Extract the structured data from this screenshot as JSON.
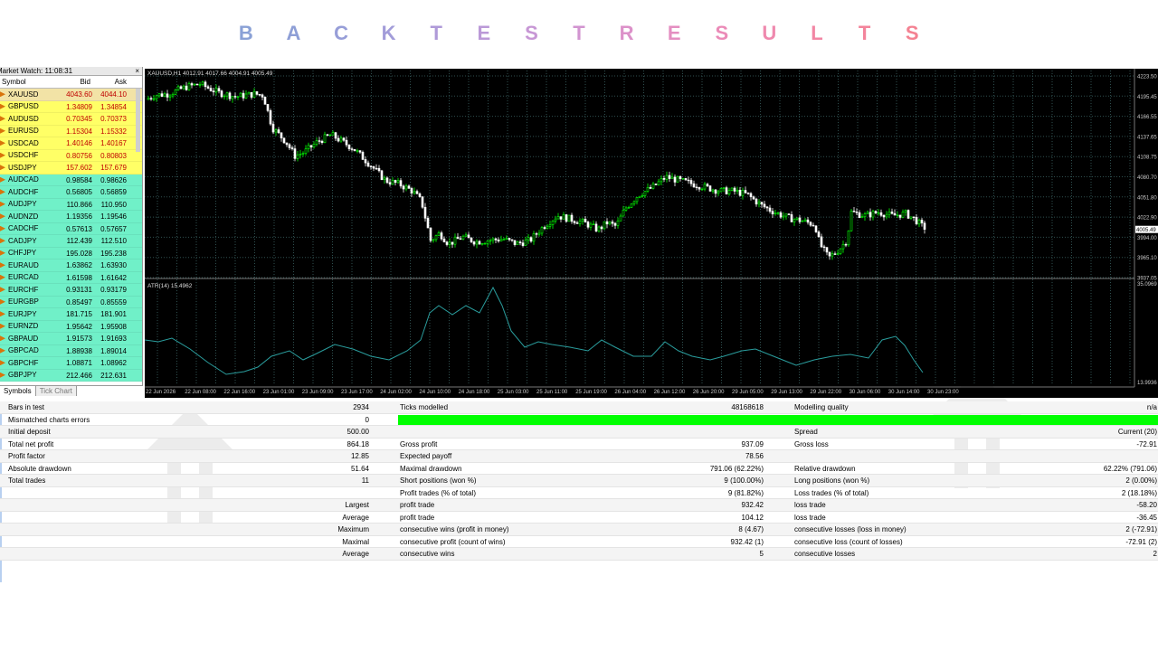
{
  "title": {
    "letters": [
      "B",
      "A",
      "C",
      "K",
      "T",
      "E",
      "S",
      "T",
      "R",
      "E",
      "S",
      "U",
      "L",
      "T",
      "S"
    ],
    "colors": [
      "#8aa1d6",
      "#8e9fd6",
      "#979ed8",
      "#a29cd9",
      "#af9ad8",
      "#bb99d7",
      "#c797d5",
      "#d294d0",
      "#dc91c9",
      "#e48ec1",
      "#eb8bb8",
      "#ef89ae",
      "#f286a4",
      "#f3849b",
      "#f48292"
    ]
  },
  "market_watch": {
    "title": "Market Watch: 11:08:31",
    "close": "×",
    "headers": {
      "symbol": "Symbol",
      "bid": "Bid",
      "ask": "Ask"
    },
    "rows": [
      {
        "symbol": "XAUUSD",
        "bid": "4043.60",
        "ask": "4044.10",
        "group": "y sel"
      },
      {
        "symbol": "GBPUSD",
        "bid": "1.34809",
        "ask": "1.34854",
        "group": "y"
      },
      {
        "symbol": "AUDUSD",
        "bid": "0.70345",
        "ask": "0.70373",
        "group": "y"
      },
      {
        "symbol": "EURUSD",
        "bid": "1.15304",
        "ask": "1.15332",
        "group": "y"
      },
      {
        "symbol": "USDCAD",
        "bid": "1.40146",
        "ask": "1.40167",
        "group": "y"
      },
      {
        "symbol": "USDCHF",
        "bid": "0.80756",
        "ask": "0.80803",
        "group": "y"
      },
      {
        "symbol": "USDJPY",
        "bid": "157.602",
        "ask": "157.679",
        "group": "y"
      },
      {
        "symbol": "AUDCAD",
        "bid": "0.98584",
        "ask": "0.98626",
        "group": "g"
      },
      {
        "symbol": "AUDCHF",
        "bid": "0.56805",
        "ask": "0.56859",
        "group": "g"
      },
      {
        "symbol": "AUDJPY",
        "bid": "110.866",
        "ask": "110.950",
        "group": "g"
      },
      {
        "symbol": "AUDNZD",
        "bid": "1.19356",
        "ask": "1.19546",
        "group": "g"
      },
      {
        "symbol": "CADCHF",
        "bid": "0.57613",
        "ask": "0.57657",
        "group": "g"
      },
      {
        "symbol": "CADJPY",
        "bid": "112.439",
        "ask": "112.510",
        "group": "g"
      },
      {
        "symbol": "CHFJPY",
        "bid": "195.028",
        "ask": "195.238",
        "group": "g"
      },
      {
        "symbol": "EURAUD",
        "bid": "1.63862",
        "ask": "1.63930",
        "group": "g"
      },
      {
        "symbol": "EURCAD",
        "bid": "1.61598",
        "ask": "1.61642",
        "group": "g"
      },
      {
        "symbol": "EURCHF",
        "bid": "0.93131",
        "ask": "0.93179",
        "group": "g"
      },
      {
        "symbol": "EURGBP",
        "bid": "0.85497",
        "ask": "0.85559",
        "group": "g"
      },
      {
        "symbol": "EURJPY",
        "bid": "181.715",
        "ask": "181.901",
        "group": "g"
      },
      {
        "symbol": "EURNZD",
        "bid": "1.95642",
        "ask": "1.95908",
        "group": "g"
      },
      {
        "symbol": "GBPAUD",
        "bid": "1.91573",
        "ask": "1.91693",
        "group": "g"
      },
      {
        "symbol": "GBPCAD",
        "bid": "1.88938",
        "ask": "1.89014",
        "group": "g"
      },
      {
        "symbol": "GBPCHF",
        "bid": "1.08871",
        "ask": "1.08962",
        "group": "g"
      },
      {
        "symbol": "GBPJPY",
        "bid": "212.466",
        "ask": "212.631",
        "group": "g"
      }
    ],
    "tabs": [
      "Symbols",
      "Tick Chart"
    ]
  },
  "chart": {
    "header": "XAUUSD,H1  4012.91 4017.66 4004.91 4005.49",
    "indicator_label": "ATR(14) 15.4962",
    "price_ticks": [
      "4223.50",
      "4195.45",
      "4166.55",
      "4137.65",
      "4108.75",
      "4080.70",
      "4051.80",
      "4022.90",
      "3994.00",
      "3965.10",
      "3937.05"
    ],
    "current_price": "4005.49",
    "atr_ticks": [
      "35.0969",
      "13.9936"
    ],
    "time_ticks": [
      "22 Jun 2026",
      "22 Jun 08:00",
      "22 Jun 16:00",
      "23 Jun 01:00",
      "23 Jun 09:00",
      "23 Jun 17:00",
      "24 Jun 02:00",
      "24 Jun 10:00",
      "24 Jun 18:00",
      "25 Jun 03:00",
      "25 Jun 11:00",
      "25 Jun 19:00",
      "26 Jun 04:00",
      "26 Jun 12:00",
      "26 Jun 20:00",
      "29 Jun 05:00",
      "29 Jun 13:00",
      "29 Jun 22:00",
      "30 Jun 06:00",
      "30 Jun 14:00",
      "30 Jun 23:00"
    ],
    "colors": {
      "bg": "#000000",
      "grid": "#2f4f4f",
      "bull": "#00ff00",
      "bear": "#ffffff",
      "atr": "#2a9d9d"
    }
  },
  "report": {
    "rows": [
      {
        "l1": "Bars in test",
        "v1": "2934",
        "l2": "Ticks modelled",
        "v2": "48168618",
        "l3": "Modelling quality",
        "v3": "n/a"
      },
      {
        "l1": "Mismatched charts errors",
        "v1": "0",
        "l2": "",
        "v2": "",
        "l3": "",
        "v3": "",
        "bar": true
      },
      {
        "l1": "Initial deposit",
        "v1": "500.00",
        "l2": "",
        "v2": "",
        "l3": "Spread",
        "v3": "Current (20)"
      },
      {
        "l1": "Total net profit",
        "v1": "864.18",
        "l2": "Gross profit",
        "v2": "937.09",
        "l3": "Gross loss",
        "v3": "-72.91"
      },
      {
        "l1": "Profit factor",
        "v1": "12.85",
        "l2": "Expected payoff",
        "v2": "78.56",
        "l3": "",
        "v3": ""
      },
      {
        "l1": "Absolute drawdown",
        "v1": "51.64",
        "l2": "Maximal drawdown",
        "v2": "791.06 (62.22%)",
        "l3": "Relative drawdown",
        "v3": "62.22% (791.06)"
      },
      {
        "l1": "Total trades",
        "v1": "11",
        "l2": "Short positions (won %)",
        "v2": "9 (100.00%)",
        "l3": "Long positions (won %)",
        "v3": "2 (0.00%)"
      },
      {
        "l1": "",
        "v1": "",
        "l2": "Profit trades (% of total)",
        "v2": "9 (81.82%)",
        "l3": "Loss trades (% of total)",
        "v3": "2 (18.18%)"
      },
      {
        "l1": "",
        "v1": "Largest",
        "l2": "profit trade",
        "v2": "932.42",
        "l3": "loss trade",
        "v3": "-58.20"
      },
      {
        "l1": "",
        "v1": "Average",
        "l2": "profit trade",
        "v2": "104.12",
        "l3": "loss trade",
        "v3": "-36.45"
      },
      {
        "l1": "",
        "v1": "Maximum",
        "l2": "consecutive wins (profit in money)",
        "v2": "8 (4.67)",
        "l3": "consecutive losses (loss in money)",
        "v3": "2 (-72.91)"
      },
      {
        "l1": "",
        "v1": "Maximal",
        "l2": "consecutive profit (count of wins)",
        "v2": "932.42 (1)",
        "l3": "consecutive loss (count of losses)",
        "v3": "-72.91 (2)"
      },
      {
        "l1": "",
        "v1": "Average",
        "l2": "consecutive wins",
        "v2": "5",
        "l3": "consecutive losses",
        "v3": "2"
      }
    ]
  }
}
